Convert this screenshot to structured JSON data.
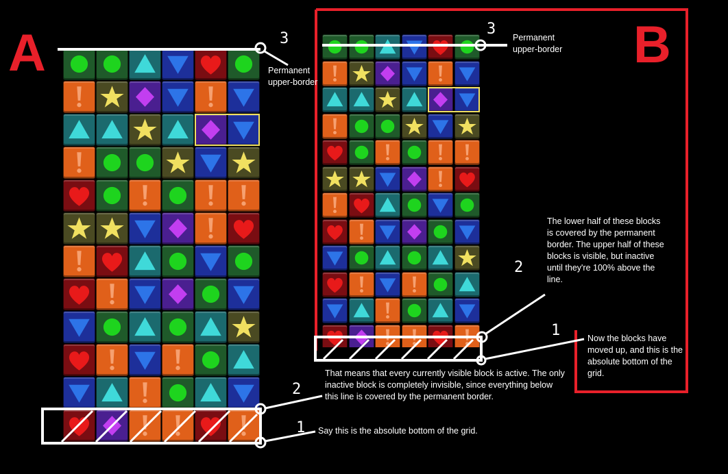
{
  "panel_a": {
    "label": "A",
    "grid": [
      [
        "circle",
        "circle",
        "tri_up",
        "tri_down",
        "heart",
        "circle"
      ],
      [
        "excl",
        "star",
        "diamond",
        "tri_down",
        "excl",
        "tri_down"
      ],
      [
        "tri_up",
        "tri_up",
        "star",
        "tri_up",
        "diamond",
        "tri_down"
      ],
      [
        "excl",
        "circle",
        "circle",
        "star",
        "tri_down",
        "star"
      ],
      [
        "heart",
        "circle",
        "excl",
        "circle",
        "excl",
        "excl"
      ],
      [
        "star",
        "star",
        "tri_down",
        "diamond",
        "excl",
        "heart"
      ],
      [
        "excl",
        "heart",
        "tri_up",
        "circle",
        "tri_down",
        "circle"
      ],
      [
        "heart",
        "excl",
        "tri_down",
        "diamond",
        "circle",
        "tri_down"
      ],
      [
        "tri_down",
        "circle",
        "tri_up",
        "circle",
        "tri_up",
        "star"
      ],
      [
        "heart",
        "excl",
        "tri_down",
        "excl",
        "circle",
        "tri_up"
      ],
      [
        "tri_down",
        "tri_up",
        "excl",
        "circle",
        "tri_up",
        "tri_down"
      ],
      [
        "heart",
        "diamond",
        "excl",
        "excl",
        "heart",
        "excl"
      ]
    ],
    "selected": {
      "row": 2,
      "cols": [
        4,
        5
      ]
    },
    "notes": {
      "n3": "3",
      "upper_border": "Permanent upper-border",
      "n2": "2",
      "middle": "That means that every currently visible block is active. The only inactive block is completely invisible, since everything below this line is covered by the permanent border.",
      "n1": "1",
      "bottom": "Say this is the absolute bottom of the grid."
    }
  },
  "panel_b": {
    "label": "B",
    "grid": [
      [
        "circle",
        "circle",
        "tri_up",
        "tri_down",
        "heart",
        "circle"
      ],
      [
        "excl",
        "star",
        "diamond",
        "tri_down",
        "excl",
        "tri_down"
      ],
      [
        "tri_up",
        "tri_up",
        "star",
        "tri_up",
        "diamond",
        "tri_down"
      ],
      [
        "excl",
        "circle",
        "circle",
        "star",
        "tri_down",
        "star"
      ],
      [
        "heart",
        "circle",
        "excl",
        "circle",
        "excl",
        "excl"
      ],
      [
        "star",
        "star",
        "tri_down",
        "diamond",
        "excl",
        "heart"
      ],
      [
        "excl",
        "heart",
        "tri_up",
        "circle",
        "tri_down",
        "circle"
      ],
      [
        "heart",
        "excl",
        "tri_down",
        "diamond",
        "circle",
        "tri_down"
      ],
      [
        "tri_down",
        "circle",
        "tri_up",
        "circle",
        "tri_up",
        "star"
      ],
      [
        "heart",
        "excl",
        "tri_down",
        "excl",
        "circle",
        "tri_up"
      ],
      [
        "tri_down",
        "tri_up",
        "excl",
        "circle",
        "tri_up",
        "tri_down"
      ],
      [
        "heart",
        "diamond",
        "excl",
        "excl",
        "heart",
        "excl"
      ]
    ],
    "selected": {
      "row": 2,
      "cols": [
        4,
        5
      ]
    },
    "notes": {
      "n3": "3",
      "upper_border": "Permanent upper-border",
      "n2": "2",
      "middle": "The lower half of these blocks is covered by the permanent border. The upper half of these blocks is visible, but inactive until they're 100% above the line.",
      "n1": "1",
      "bottom": "Now the blocks have moved up, and this is the absolute bottom of the grid."
    }
  },
  "colors": {
    "accent_red": "#e8202a",
    "circle": "#1f5a2a",
    "tri_up": "#1b6a6e",
    "tri_down": "#1d2f9a",
    "heart": "#7a0d12",
    "excl": "#e0601a",
    "star": "#4a4a22",
    "diamond": "#4a1f90",
    "selection": "#f0e060"
  }
}
